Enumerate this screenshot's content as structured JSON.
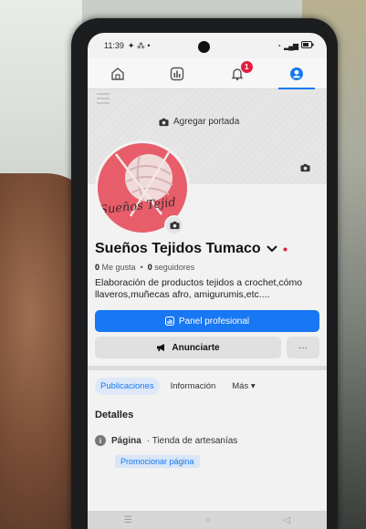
{
  "status_bar": {
    "time": "11:39",
    "battery": "4"
  },
  "nav": {
    "notifications_badge": "1"
  },
  "cover": {
    "add_cover_label": "Agregar portada"
  },
  "avatar": {
    "logo_text": "Sueños Tejid"
  },
  "profile": {
    "name": "Sueños Tejidos Tumaco",
    "likes_count": "0",
    "likes_label": "Me gusta",
    "followers_count": "0",
    "followers_label": "seguidores",
    "bio": "Elaboración de productos tejidos a crochet,cómo llaveros,muñecas afro, amigurumis,etc...."
  },
  "actions": {
    "professional_panel": "Panel profesional",
    "advertise": "Anunciarte",
    "more": "···"
  },
  "tabs": {
    "posts": "Publicaciones",
    "info": "Información",
    "more": "Más"
  },
  "details": {
    "title": "Detalles",
    "page_label": "Página",
    "page_category": "· Tienda de artesanías",
    "promote": "Promocionar página"
  },
  "colors": {
    "accent": "#1877f2",
    "badge": "#e41e3f",
    "avatar": "#e85d6a"
  }
}
